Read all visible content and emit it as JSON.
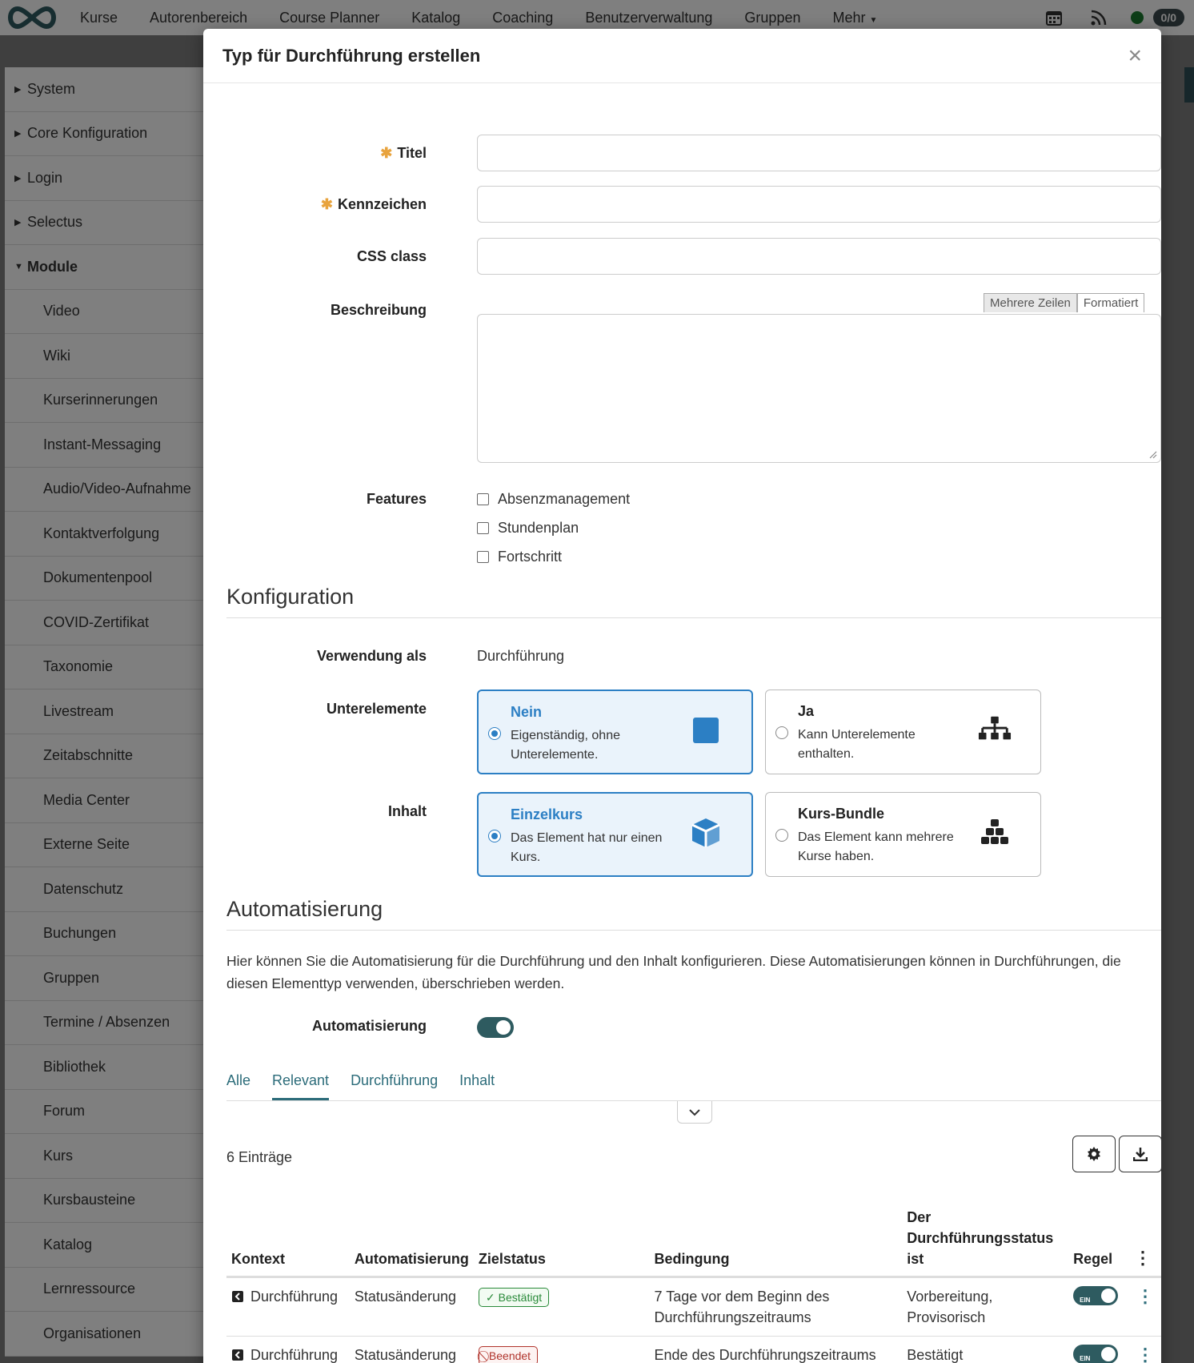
{
  "topnav": {
    "items": [
      "Kurse",
      "Autorenbereich",
      "Course Planner",
      "Katalog",
      "Coaching",
      "Benutzerverwaltung",
      "Gruppen",
      "Mehr"
    ],
    "badge": "0/0"
  },
  "sidebar": {
    "top_items": [
      "System",
      "Core Konfiguration",
      "Login",
      "Selectus",
      "Module"
    ],
    "sub_items": [
      "Video",
      "Wiki",
      "Kurserinnerungen",
      "Instant-Messaging",
      "Audio/Video-Aufnahme",
      "Kontaktverfolgung",
      "Dokumentenpool",
      "COVID-Zertifikat",
      "Taxonomie",
      "Livestream",
      "Zeitabschnitte",
      "Media Center",
      "Externe Seite",
      "Datenschutz",
      "Buchungen",
      "Gruppen",
      "Termine / Absenzen",
      "Bibliothek",
      "Forum",
      "Kurs",
      "Kursbausteine",
      "Katalog",
      "Lernressource",
      "Organisationen"
    ]
  },
  "modal": {
    "title": "Typ für Durchführung erstellen",
    "close": "×",
    "fields": {
      "titel": "Titel",
      "kennzeichen": "Kennzeichen",
      "css_class": "CSS class",
      "beschreibung": "Beschreibung",
      "features": "Features"
    },
    "textarea_tabs": [
      "Mehrere Zeilen",
      "Formatiert"
    ],
    "features": [
      "Absenzmanagement",
      "Stundenplan",
      "Fortschritt"
    ],
    "konfiguration": {
      "heading": "Konfiguration",
      "verwendung_label": "Verwendung als",
      "verwendung_value": "Durchführung",
      "unterelemente_label": "Unterelemente",
      "inhalt_label": "Inhalt",
      "unterelemente_cards": [
        {
          "title": "Nein",
          "desc": "Eigenständig, ohne Unterelemente.",
          "selected": true
        },
        {
          "title": "Ja",
          "desc": "Kann Unterelemente enthalten.",
          "selected": false
        }
      ],
      "inhalt_cards": [
        {
          "title": "Einzelkurs",
          "desc": "Das Element hat nur einen Kurs.",
          "selected": true
        },
        {
          "title": "Kurs-Bundle",
          "desc": "Das Element kann mehrere Kurse haben.",
          "selected": false
        }
      ]
    },
    "automatisierung": {
      "heading": "Automatisierung",
      "paragraph": "Hier können Sie die Automatisierung für die Durchführung und den Inhalt konfigurieren. Diese Automatisierungen können in Durchführungen, die diesen Elementtyp verwenden, überschrieben werden.",
      "toggle_label": "Automatisierung",
      "tabs": [
        "Alle",
        "Relevant",
        "Durchführung",
        "Inhalt"
      ],
      "active_tab": "Relevant",
      "count": "6 Einträge",
      "table": {
        "headers": [
          "Kontext",
          "Automatisierung",
          "Zielstatus",
          "Bedingung",
          "Der Durchführungsstatus ist",
          "Regel"
        ],
        "rows": [
          {
            "kontext": "Durchführung",
            "automatisierung": "Statusänderung",
            "zielstatus": "Bestätigt",
            "status_kind": "ok",
            "bedingung": "7 Tage vor dem Beginn des Durchführungszeitraums",
            "status": "Vorbereitung, Provisorisch",
            "regel": "EIN"
          },
          {
            "kontext": "Durchführung",
            "automatisierung": "Statusänderung",
            "zielstatus": "Beendet",
            "status_kind": "end",
            "bedingung": "Ende des Durchführungszeitraums",
            "status": "Bestätigt",
            "regel": "EIN"
          }
        ]
      }
    }
  },
  "colors": {
    "accent": "#2c7fc4",
    "teal": "#2e5b60",
    "required": "#e8a33d",
    "success": "#2a8a3a",
    "danger": "#b0332b"
  }
}
